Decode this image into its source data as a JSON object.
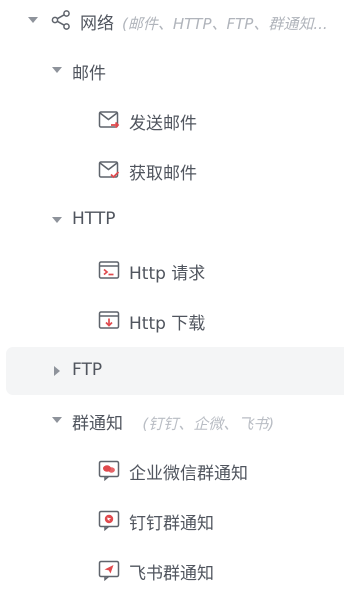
{
  "tree": {
    "root": {
      "label": "网络",
      "hint": "(邮件、HTTP、FTP、群通知...",
      "icon": "share-network-icon",
      "expanded": true
    },
    "groups": [
      {
        "key": "mail",
        "label": "邮件",
        "expanded": true,
        "children": [
          {
            "label": "发送邮件",
            "icon": "mail-send-icon"
          },
          {
            "label": "获取邮件",
            "icon": "mail-receive-icon"
          }
        ]
      },
      {
        "key": "http",
        "label": "HTTP",
        "expanded": true,
        "children": [
          {
            "label": "Http 请求",
            "icon": "http-request-icon"
          },
          {
            "label": "Http 下载",
            "icon": "http-download-icon"
          }
        ]
      },
      {
        "key": "ftp",
        "label": "FTP",
        "expanded": false,
        "selected": true,
        "children": []
      },
      {
        "key": "notify",
        "label": "群通知",
        "hint": "(钉钉、企微、飞书)",
        "expanded": true,
        "children": [
          {
            "label": "企业微信群通知",
            "icon": "wecom-icon"
          },
          {
            "label": "钉钉群通知",
            "icon": "dingtalk-icon"
          },
          {
            "label": "飞书群通知",
            "icon": "feishu-icon"
          }
        ]
      }
    ]
  },
  "colors": {
    "accent": "#e0494d",
    "icon_stroke": "#5f646c",
    "selected_bg": "#f4f5f6",
    "hint": "#b0b4bb"
  }
}
